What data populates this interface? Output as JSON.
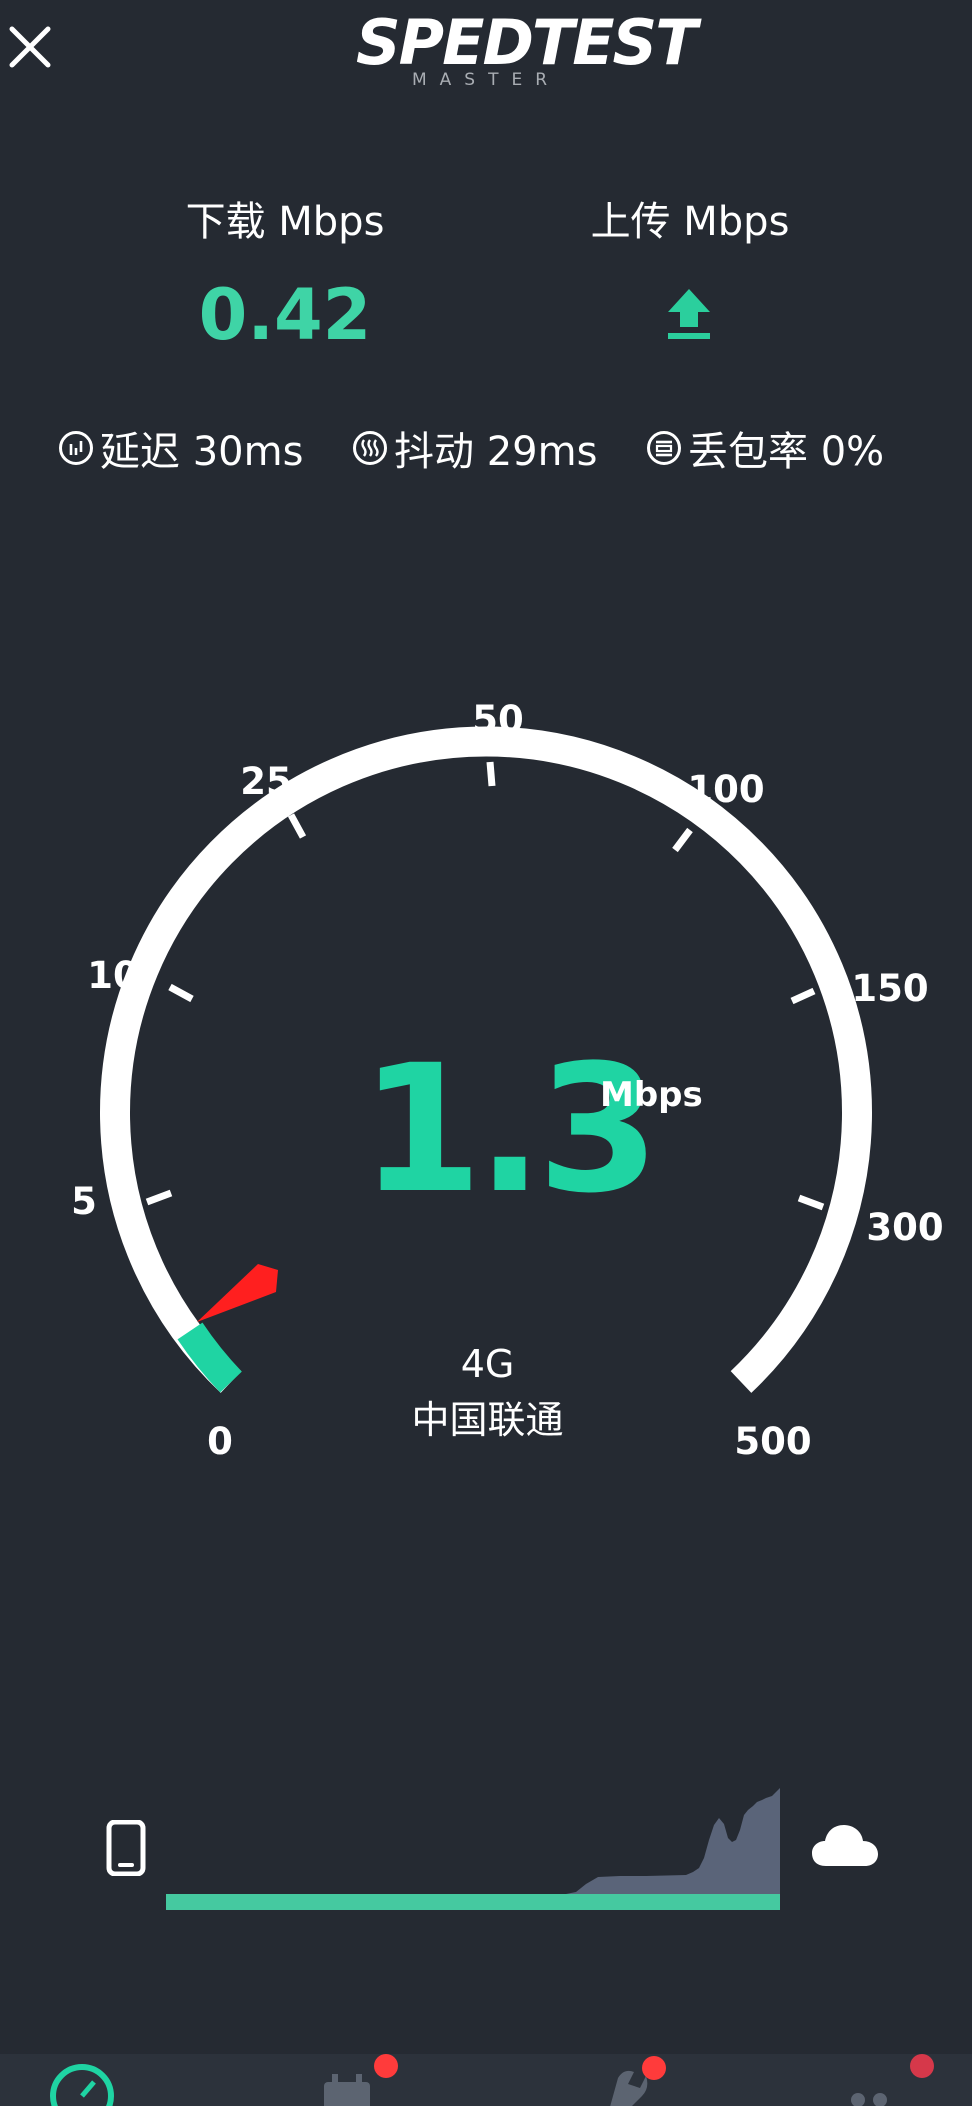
{
  "header": {
    "logo_main": "SPEDTEST",
    "logo_sub": "MASTER"
  },
  "results": {
    "download_label": "下载 Mbps",
    "download_value": "0.42",
    "upload_label": "上传 Mbps"
  },
  "stats": {
    "latency": "延迟 30ms",
    "jitter": "抖动 29ms",
    "packet_loss": "丢包率 0%"
  },
  "gauge": {
    "scale_labels": [
      "0",
      "5",
      "10",
      "25",
      "50",
      "100",
      "150",
      "300",
      "500"
    ],
    "current_speed": "1.3",
    "unit": "Mbps",
    "accent_color": "#1fd4a3",
    "needle_color": "#ff1f1f"
  },
  "connection": {
    "network_type": "4G",
    "carrier": "中国联通"
  },
  "colors": {
    "background": "#252a32",
    "download_green": "#3fd4a6",
    "graph_fill": "#5a6479",
    "graph_baseline": "#45c9a0"
  },
  "icons": {
    "close": "close-icon",
    "upload": "upload-arrow-icon",
    "latency": "latency-icon",
    "jitter": "jitter-icon",
    "packet_loss": "packet-loss-icon",
    "phone": "phone-icon",
    "cloud": "cloud-icon"
  },
  "bottom_nav": {
    "items": [
      "speedtest-icon",
      "history-icon",
      "tools-icon",
      "more-icon"
    ],
    "badge_color": "#ff3b3b"
  }
}
